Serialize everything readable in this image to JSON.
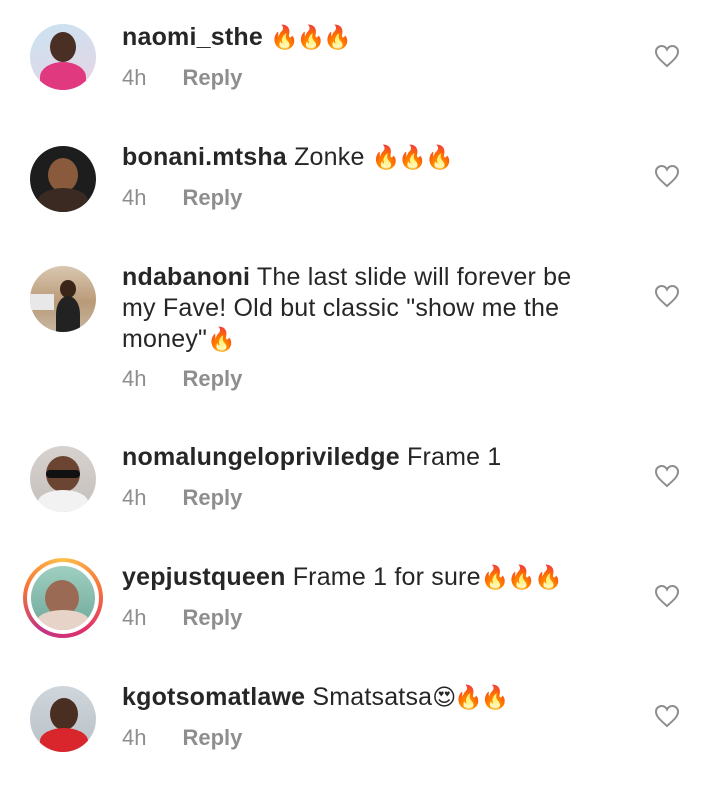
{
  "reply_label": "Reply",
  "comments": [
    {
      "username": "naomi_sthe",
      "text": " ",
      "emoji": "🔥🔥🔥",
      "time": "4h"
    },
    {
      "username": "bonani.mtsha",
      "text": " Zonke ",
      "emoji": "🔥🔥🔥",
      "time": "4h"
    },
    {
      "username": "ndabanoni",
      "text": " The last slide will forever be my Fave! Old but classic \"show me the money\"",
      "emoji": "🔥",
      "time": "4h"
    },
    {
      "username": "nomalungelopriviledge",
      "text": " Frame 1",
      "emoji": "",
      "time": "4h"
    },
    {
      "username": "yepjustqueen",
      "text": " Frame 1 for sure",
      "emoji": "🔥🔥🔥",
      "time": "4h"
    },
    {
      "username": "kgotsomatlawe",
      "text": " Smatsatsa",
      "emoji": "😍🔥🔥",
      "time": "4h"
    }
  ],
  "icons": {
    "like": "heart-outline-icon"
  }
}
